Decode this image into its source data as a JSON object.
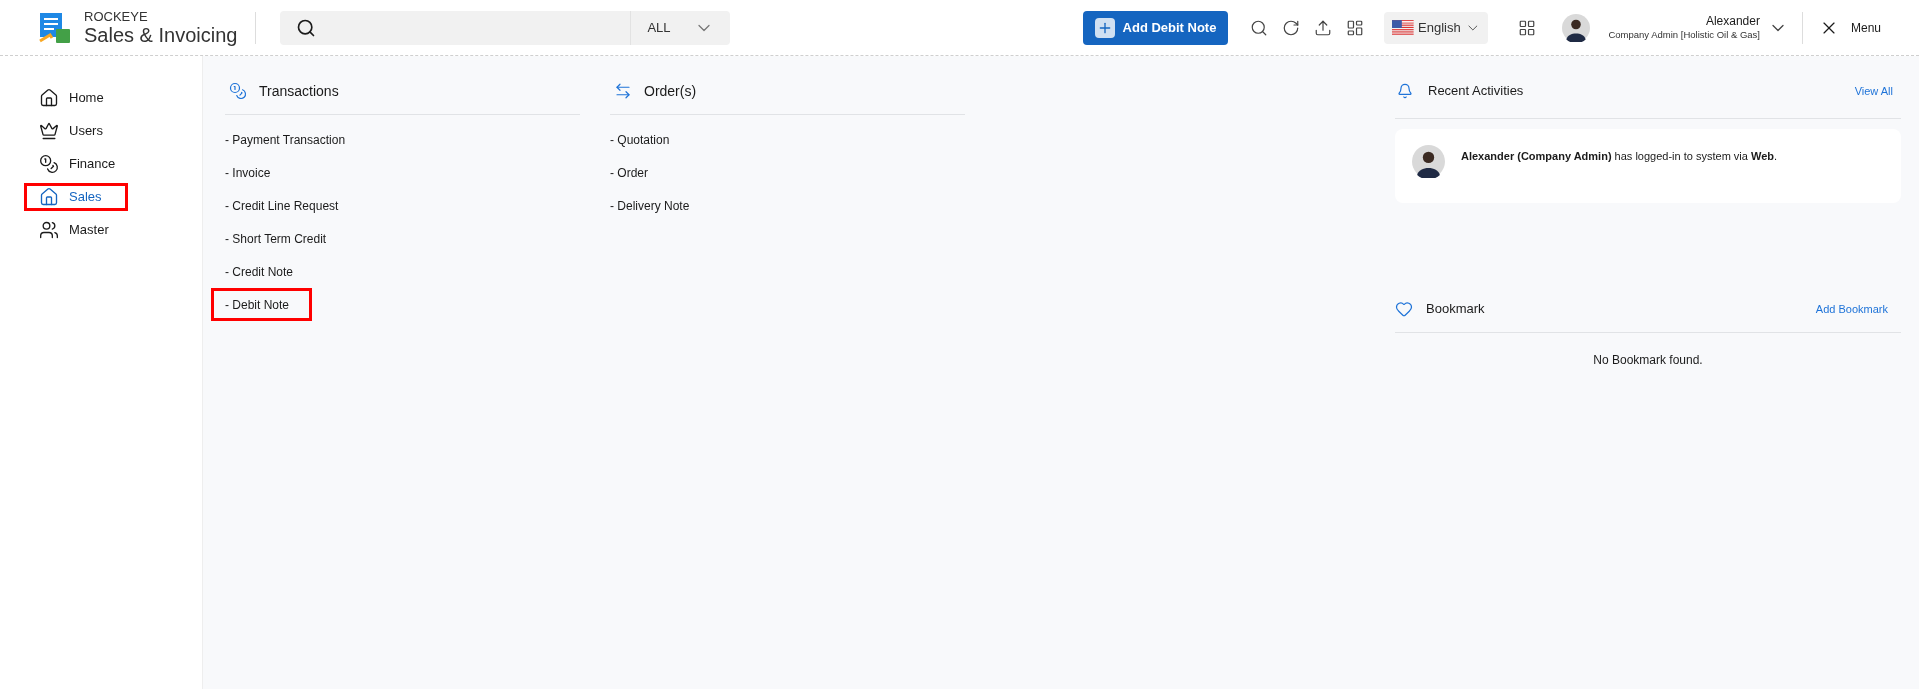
{
  "header": {
    "brand_top": "ROCKEYE",
    "brand_name": "Sales & Invoicing",
    "search": {
      "scope": "ALL"
    },
    "primary_button": "Add Debit Note",
    "language": "English",
    "user": {
      "name": "Alexander",
      "role": "Company Admin [Holistic Oil & Gas]"
    },
    "menu_label": "Menu"
  },
  "sidebar": {
    "items": [
      {
        "label": "Home",
        "kind": "home",
        "selected": false,
        "highlighted": false
      },
      {
        "label": "Users",
        "kind": "crown",
        "selected": false,
        "highlighted": false
      },
      {
        "label": "Finance",
        "kind": "coins",
        "selected": false,
        "highlighted": false
      },
      {
        "label": "Sales",
        "kind": "home",
        "selected": true,
        "highlighted": true
      },
      {
        "label": "Master",
        "kind": "users",
        "selected": false,
        "highlighted": false
      }
    ]
  },
  "sections": [
    {
      "title": "Transactions",
      "kind": "coins",
      "links": [
        {
          "label": "- Payment Transaction",
          "highlighted": false
        },
        {
          "label": "- Invoice",
          "highlighted": false
        },
        {
          "label": "- Credit Line Request",
          "highlighted": false
        },
        {
          "label": "- Short Term Credit",
          "highlighted": false
        },
        {
          "label": "- Credit Note",
          "highlighted": false
        },
        {
          "label": "- Debit Note",
          "highlighted": true
        }
      ]
    },
    {
      "title": "Order(s)",
      "kind": "swap",
      "links": [
        {
          "label": "- Quotation",
          "highlighted": false
        },
        {
          "label": "- Order",
          "highlighted": false
        },
        {
          "label": "- Delivery Note",
          "highlighted": false
        }
      ]
    }
  ],
  "recent_activities": {
    "title": "Recent Activities",
    "action": "View All",
    "items": [
      {
        "text": "**Alexander (Company Admin)** has logged-in to system via **Web**."
      }
    ]
  },
  "bookmark": {
    "title": "Bookmark",
    "action": "Add Bookmark",
    "empty": "No Bookmark found."
  }
}
